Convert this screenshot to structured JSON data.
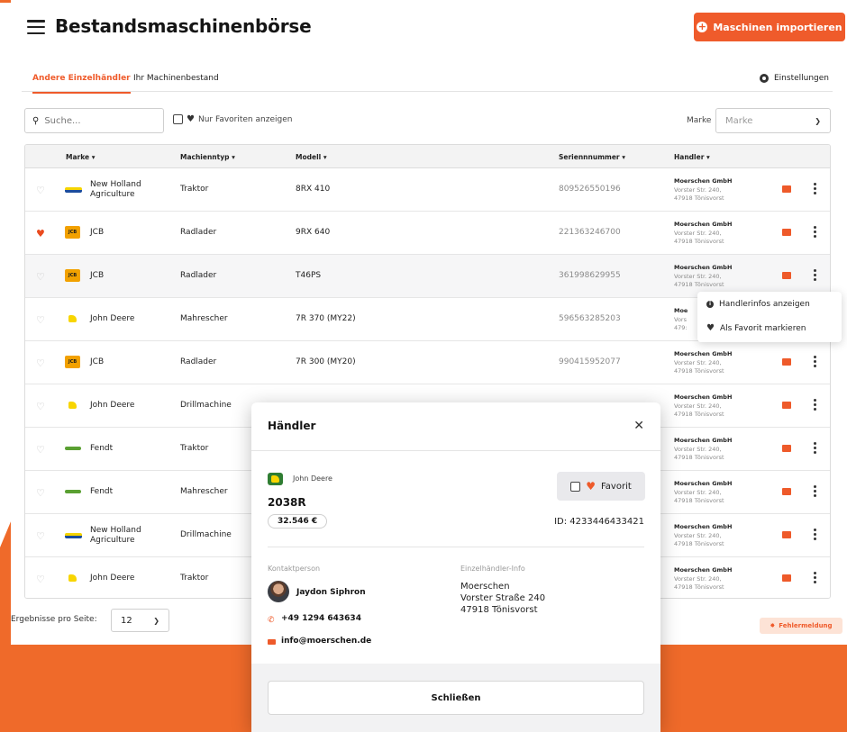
{
  "header": {
    "title": "Bestandsmaschinenbörse",
    "import_label": "Maschinen importieren"
  },
  "tabs": [
    {
      "label": "Andere Einzelhändler",
      "active": true
    },
    {
      "label": "Ihr Machinenbestand",
      "active": false
    }
  ],
  "settings_label": "Einstellungen",
  "filters": {
    "search_placeholder": "Suche...",
    "favorites_label": "Nur Favoriten anzeigen",
    "marke_label": "Marke",
    "marke_placeholder": "Marke"
  },
  "table": {
    "headers": {
      "marke": "Marke",
      "typ": "Machienntyp",
      "modell": "Modell",
      "serie": "Seriennnummer",
      "haendler": "Handler"
    },
    "rows": [
      {
        "fav": false,
        "logo": "new-holland-logo",
        "marke1": "New Holland",
        "marke2": "Agriculture",
        "typ": "Traktor",
        "modell": "8RX 410",
        "serie": "809526550196",
        "hname": "Moerschen GmbH",
        "hstreet": "Vorster Str. 240,",
        "hcity": "47918 Tönisvorst"
      },
      {
        "fav": true,
        "logo": "jcb-logo",
        "marke1": "JCB",
        "marke2": "",
        "typ": "Radlader",
        "modell": "9RX 640",
        "serie": "221363246700",
        "hname": "Moerschen GmbH",
        "hstreet": "Vorster Str. 240,",
        "hcity": "47918 Tönisvorst"
      },
      {
        "fav": false,
        "logo": "jcb-logo",
        "marke1": "JCB",
        "marke2": "",
        "typ": "Radlader",
        "modell": "T46PS",
        "serie": "361998629955",
        "hname": "Moerschen GmbH",
        "hstreet": "Vorster Str. 240,",
        "hcity": "47918 Tönisvorst"
      },
      {
        "fav": false,
        "logo": "john-deere-logo",
        "marke1": "John Deere",
        "marke2": "",
        "typ": "Mahrescher",
        "modell": "7R 370 (MY22)",
        "serie": "596563285203",
        "hname": "Moe",
        "hstreet": "Vors",
        "hcity": "479:"
      },
      {
        "fav": false,
        "logo": "jcb-logo",
        "marke1": "JCB",
        "marke2": "",
        "typ": "Radlader",
        "modell": "7R 300 (MY20)",
        "serie": "990415952077",
        "hname": "Moerschen GmbH",
        "hstreet": "Vorster Str. 240,",
        "hcity": "47918 Tönisvorst"
      },
      {
        "fav": false,
        "logo": "john-deere-logo",
        "marke1": "John Deere",
        "marke2": "",
        "typ": "Drillmachine",
        "modell": "",
        "serie": "",
        "hname": "Moerschen GmbH",
        "hstreet": "Vorster Str. 240,",
        "hcity": "47918 Tönisvorst"
      },
      {
        "fav": false,
        "logo": "fendt-logo",
        "marke1": "Fendt",
        "marke2": "",
        "typ": "Traktor",
        "modell": "",
        "serie": "",
        "hname": "Moerschen GmbH",
        "hstreet": "Vorster Str. 240,",
        "hcity": "47918 Tönisvorst"
      },
      {
        "fav": false,
        "logo": "fendt-logo",
        "marke1": "Fendt",
        "marke2": "",
        "typ": "Mahrescher",
        "modell": "",
        "serie": "",
        "hname": "Moerschen GmbH",
        "hstreet": "Vorster Str. 240,",
        "hcity": "47918 Tönisvorst"
      },
      {
        "fav": false,
        "logo": "new-holland-logo",
        "marke1": "New Holland",
        "marke2": "Agriculture",
        "typ": "Drillmachine",
        "modell": "",
        "serie": "",
        "hname": "Moerschen GmbH",
        "hstreet": "Vorster Str. 240,",
        "hcity": "47918 Tönisvorst"
      },
      {
        "fav": false,
        "logo": "john-deere-logo",
        "marke1": "John Deere",
        "marke2": "",
        "typ": "Traktor",
        "modell": "",
        "serie": "",
        "hname": "Moerschen GmbH",
        "hstreet": "Vorster Str. 240,",
        "hcity": "47918 Tönisvorst"
      }
    ]
  },
  "context_menu": {
    "item1": "Handlerinfos anzeigen",
    "item2": "Als Favorit markieren"
  },
  "pagination": {
    "label": "Ergebnisse pro Seite:",
    "value": "12"
  },
  "error_label": "Fehlermeldung",
  "modal": {
    "title": "Händler",
    "brand": "John Deere",
    "model": "2038R",
    "price": "32.546 €",
    "favorit_label": "Favorit",
    "id": "ID: 4233446433421",
    "kontakt_label": "Kontaktperson",
    "contact_name": "Jaydon Siphron",
    "phone": "+49 1294 643634",
    "email": "info@moerschen.de",
    "haendler_label": "Einzelhändler-Info",
    "h_line1": "Moerschen",
    "h_line2": "Vorster Straße 240",
    "h_line3": "47918 Tönisvorst",
    "close_button": "Schließen"
  },
  "colors": {
    "accent": "#ef5b2b",
    "background_orange": "#ef6a2a"
  }
}
